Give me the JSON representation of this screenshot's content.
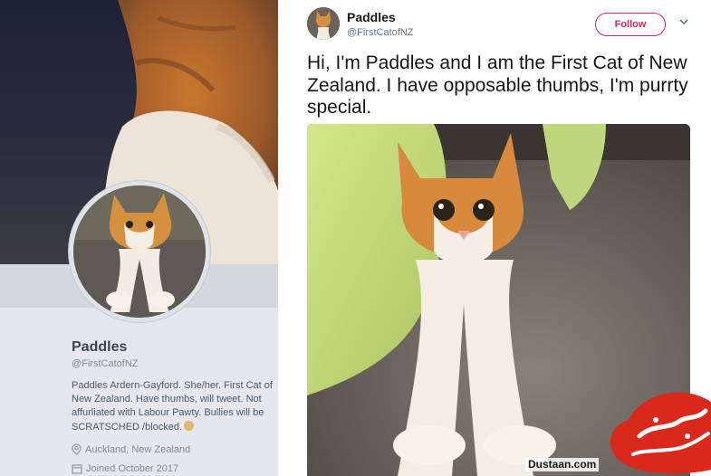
{
  "profile": {
    "name": "Paddles",
    "handle": "@FirstCatofNZ",
    "bio": "Paddles Ardern-Gayford. She/her. First Cat of New Zealand. Have thumbs, will tweet. Not affurliated with Labour Pawty. Bullies will be SCRATSCHED /blocked.",
    "location": "Auckland, New Zealand",
    "joined": "Joined October 2017"
  },
  "tweet": {
    "name": "Paddles",
    "handle": "@FirstCatofNZ",
    "follow_label": "Follow",
    "text": "Hi, I'm Paddles and I am the First Cat of New Zealand. I have opposable thumbs, I'm purrty special."
  },
  "colors": {
    "accent": "#e0245e",
    "name_text": "#14171a",
    "secondary_text": "#657786",
    "profile_bg": "#e4e8ec"
  },
  "icons": [
    "location-pin-icon",
    "calendar-icon",
    "chevron-down-icon",
    "hug-emoji-icon"
  ],
  "watermark": {
    "site": "Dustaan.com",
    "logo_text": "مجله دوستان"
  }
}
